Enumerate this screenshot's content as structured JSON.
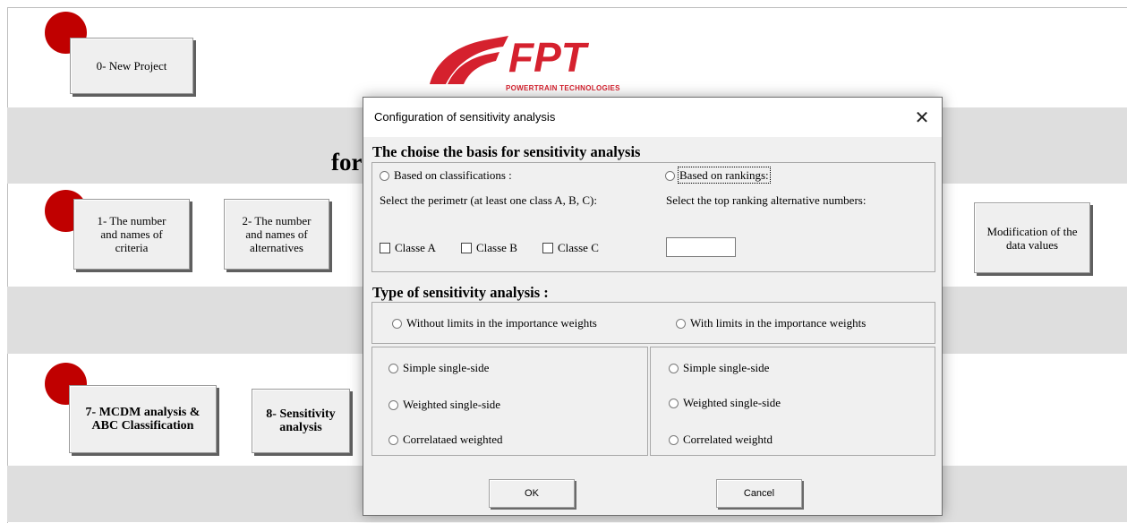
{
  "sheet": {
    "bg_text": "for",
    "buttons": {
      "new_project": "0- New Project",
      "criteria_line1": "1- The number",
      "criteria_line2": "and names of",
      "criteria_line3": "criteria",
      "alternatives_line1": "2- The number",
      "alternatives_line2": "and names of",
      "alternatives_line3": "alternatives",
      "modification_line1": "Modification of the",
      "modification_line2": "data values",
      "mcdm_line1": "7- MCDM analysis &",
      "mcdm_line2": "ABC Classification",
      "sensitivity_line1": "8- Sensitivity",
      "sensitivity_line2": "analysis"
    },
    "logo": {
      "wordmark": "FPT",
      "subtitle": "POWERTRAIN TECHNOLOGIES",
      "color": "#d5212e"
    },
    "marker_color": "#c00000"
  },
  "dialog": {
    "title": "Configuration of sensitivity analysis",
    "basis_header": "The choise the basis for sensitivity analysis",
    "based_on_classifications": "Based on classifications :",
    "based_on_rankings": "Based on rankings:",
    "select_perimeter": "Select the perimetr (at least one class A, B, C):",
    "select_top_ranking": "Select the top ranking alternative numbers:",
    "classes": [
      "Classe A",
      "Classe B",
      "Classe C"
    ],
    "top_ranking_value": "",
    "type_header": "Type of sensitivity analysis :",
    "without_limits": "Without limits in the importance weights",
    "with_limits": "With limits in the importance weights",
    "left_options": [
      "Simple single-side",
      "Weighted single-side",
      "Correlataed weighted"
    ],
    "right_options": [
      "Simple single-side",
      "Weighted single-side",
      "Correlated weightd"
    ],
    "ok_label": "OK",
    "cancel_label": "Cancel"
  }
}
